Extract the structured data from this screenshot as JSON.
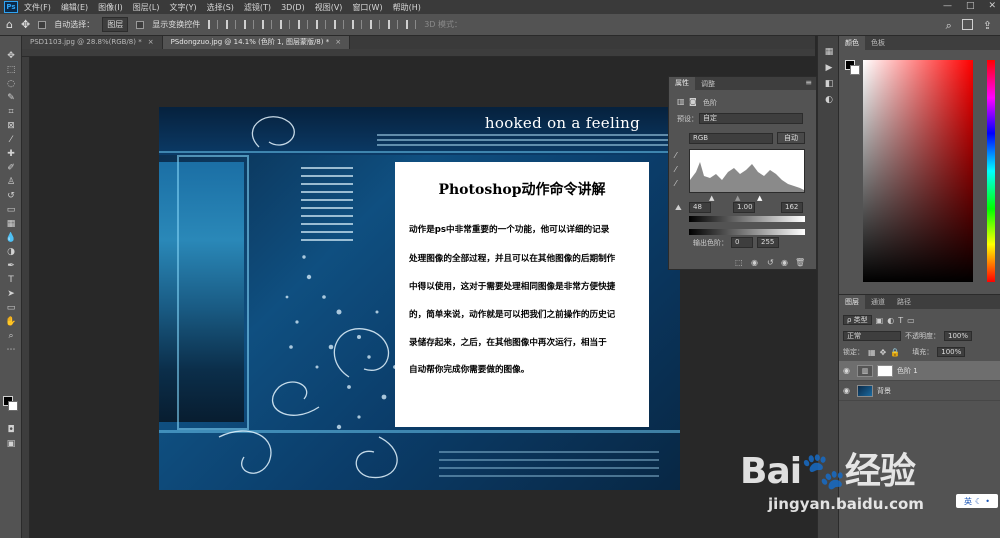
{
  "app": {
    "logo_text": "Ps",
    "menu": [
      "文件(F)",
      "编辑(E)",
      "图像(I)",
      "图层(L)",
      "文字(Y)",
      "选择(S)",
      "滤镜(T)",
      "3D(D)",
      "视图(V)",
      "窗口(W)",
      "帮助(H)"
    ],
    "window_controls": [
      "—",
      "□",
      "✕"
    ]
  },
  "options_bar": {
    "auto_select_label": "自动选择：",
    "auto_select_value": "图层",
    "show_transform_label": "显示变换控件",
    "mode_3d_label": "3D 模式："
  },
  "tabs": [
    {
      "label": "PSD1103.jpg @ 28.8%(RGB/8) *",
      "close": "×",
      "active": false
    },
    {
      "label": "PSdongzuo.jpg @ 14.1% (色阶 1, 图层蒙版/8) *",
      "close": "×",
      "active": true
    }
  ],
  "artwork": {
    "title": "hooked on a feeling",
    "card_title": "Photoshop动作命令讲解",
    "card_lines": [
      "动作是ps中非常重要的一个功能，他可以详细的记录",
      "处理图像的全部过程，并且可以在其他图像的后期制作",
      "中得以使用，这对于需要处理相同图像是非常方便快捷",
      "的，简单来说，动作就是可以把我们之前操作的历史记",
      "录储存起来，之后，在其他图像中再次运行，相当于",
      "自动帮你完成你需要做的图像。"
    ]
  },
  "properties": {
    "tab_properties": "属性",
    "tab_adjust": "调整",
    "header_label": "色阶",
    "preset_label": "预设：",
    "preset_value": "自定",
    "channel_value": "RGB",
    "auto_button": "自动",
    "input_black": "48",
    "input_gray": "1.00",
    "input_white": "162",
    "output_label": "输出色阶：",
    "output_black": "0",
    "output_white": "255"
  },
  "color_panel": {
    "tab_color": "颜色",
    "tab_swatches": "色板"
  },
  "layers_panel": {
    "tab_layers": "图层",
    "tab_channels": "通道",
    "tab_paths": "路径",
    "filter_kind": "ρ 类型",
    "blend_mode": "正常",
    "opacity_label": "不透明度：",
    "opacity_value": "100%",
    "lock_label": "锁定：",
    "fill_label": "填充：",
    "fill_value": "100%",
    "layers": [
      {
        "name": "色阶 1",
        "selected": true,
        "kind": "adjustment"
      },
      {
        "name": "背景",
        "selected": false,
        "kind": "image"
      }
    ]
  },
  "watermark": {
    "logo": "Bai🐾经验",
    "url": "jingyan.baidu.com"
  },
  "ime": {
    "label": "英"
  },
  "colors": {
    "accent_blue": "#2ea3f2",
    "panel_bg": "#535353",
    "workspace": "#282828"
  }
}
